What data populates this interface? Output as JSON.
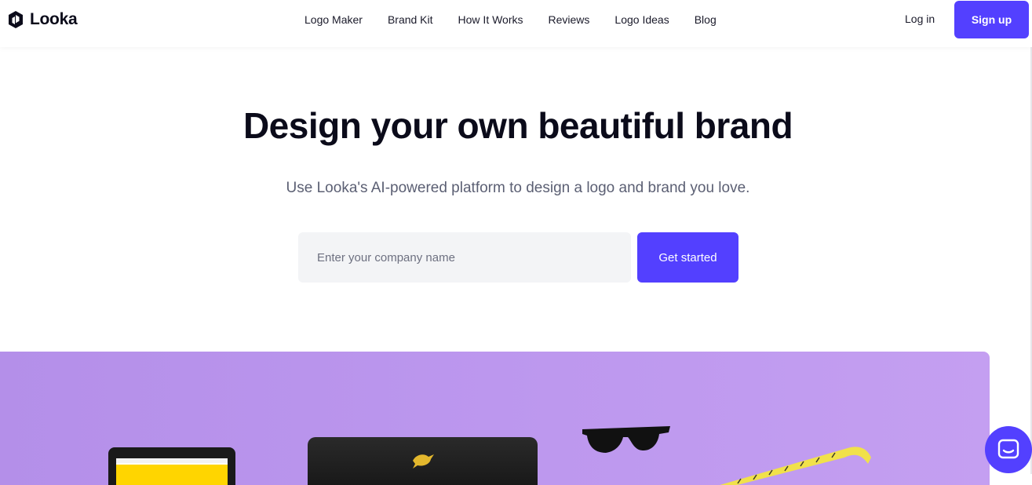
{
  "brand": {
    "name": "Looka",
    "accent_color": "#5340ff",
    "showcase_color": "#bc97ee"
  },
  "nav": {
    "items": [
      {
        "label": "Logo Maker"
      },
      {
        "label": "Brand Kit"
      },
      {
        "label": "How It Works"
      },
      {
        "label": "Reviews"
      },
      {
        "label": "Logo Ideas"
      },
      {
        "label": "Blog"
      }
    ],
    "login_label": "Log in",
    "signup_label": "Sign up"
  },
  "hero": {
    "title": "Design your own beautiful brand",
    "subtitle": "Use Looka's AI-powered platform to design a logo and brand you love.",
    "input_placeholder": "Enter your company name",
    "input_value": "",
    "cta_label": "Get started"
  },
  "icons": {
    "logo": "looka-logo-icon",
    "chat": "chat-icon"
  }
}
